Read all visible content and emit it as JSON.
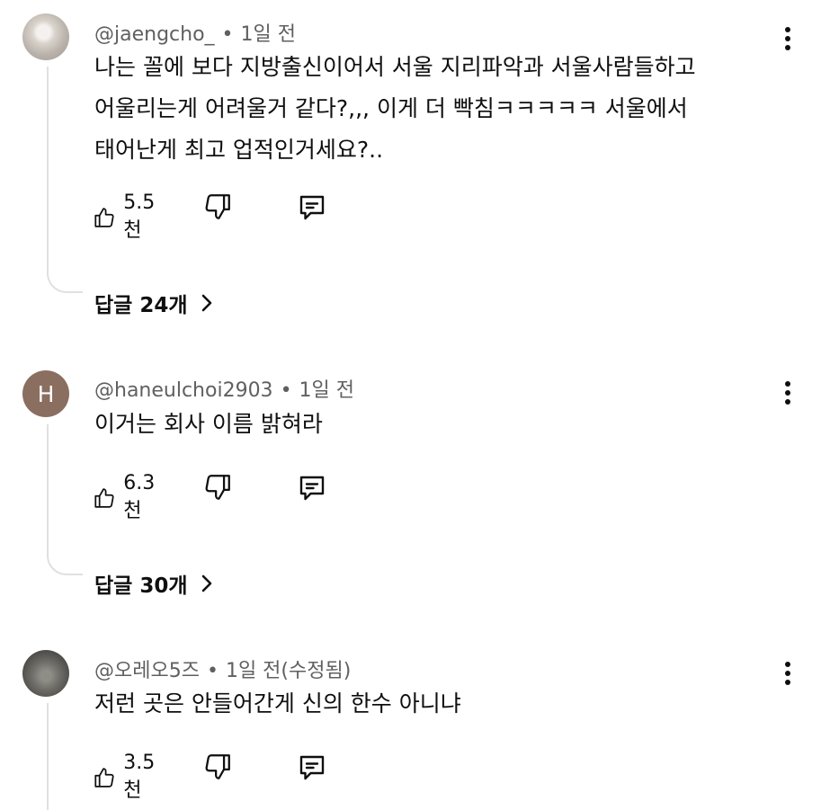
{
  "comments": [
    {
      "author": "@jaengcho_",
      "time": "1일 전",
      "lines": [
        "나는 꼴에 보다 지방출신이어서 서울 지리파악과 서울사람들하고",
        "어울리는게 어려울거 같다?,,, 이게 더 빡침ㅋㅋㅋㅋㅋ 서울에서",
        "태어난게 최고 업적인거세요?.."
      ],
      "likes": "5.5천",
      "replies": "답글 24개"
    },
    {
      "author": "@haneulchoi2903",
      "avatar_letter": "H",
      "time": "1일 전",
      "lines": [
        "이거는 회사 이름 밝혀라"
      ],
      "likes": "6.3천",
      "replies": "답글 30개"
    },
    {
      "author": "@오레오5즈",
      "time": "1일 전(수정됨)",
      "lines": [
        "저런 곳은 안들어간게 신의 한수 아니냐"
      ],
      "likes": "3.5천"
    }
  ],
  "icons": {
    "like": "thumbs-up-icon",
    "dislike": "thumbs-down-icon",
    "reply": "comment-icon",
    "more": "more-vert-icon",
    "expand": "chevron-right-icon"
  },
  "colors": {
    "text": "#0f0f0f",
    "meta": "#606060",
    "thread": "#e0e0e0",
    "avatar_h": "#8a6e60"
  }
}
